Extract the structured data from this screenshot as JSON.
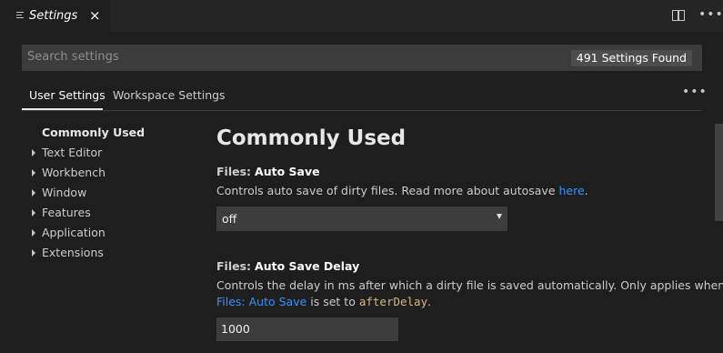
{
  "tab": {
    "title": "Settings",
    "close": "×",
    "icon": "settings-list-icon"
  },
  "toolbar": {
    "split_icon": "split-editor-icon",
    "more": "•••"
  },
  "search": {
    "placeholder": "Search settings",
    "count": "491 Settings Found"
  },
  "scopes": {
    "user": "User Settings",
    "workspace": "Workspace Settings",
    "more": "•••"
  },
  "toc": {
    "active": "Commonly Used",
    "items": [
      {
        "label": "Text Editor"
      },
      {
        "label": "Workbench"
      },
      {
        "label": "Window"
      },
      {
        "label": "Features"
      },
      {
        "label": "Application"
      },
      {
        "label": "Extensions"
      }
    ]
  },
  "main": {
    "section_title": "Commonly Used",
    "settings": [
      {
        "category": "Files:",
        "name": "Auto Save",
        "description": "Controls auto save of dirty files. Read more about autosave",
        "link": "here",
        "description_end": ".",
        "value": "off"
      },
      {
        "category": "Files:",
        "name": "Auto Save Delay",
        "description_line1": "Controls the delay in ms after which a dirty file is saved automatically. Only applies when",
        "link": "Files: Auto Save",
        "description_mid": " is set to ",
        "code": "afterDelay",
        "description_end": ".",
        "value": "1000"
      }
    ]
  },
  "colors": {
    "background": "#1e1e1e",
    "link": "#3794ff",
    "code": "#d7ba7d",
    "input": "#3c3c3c"
  }
}
